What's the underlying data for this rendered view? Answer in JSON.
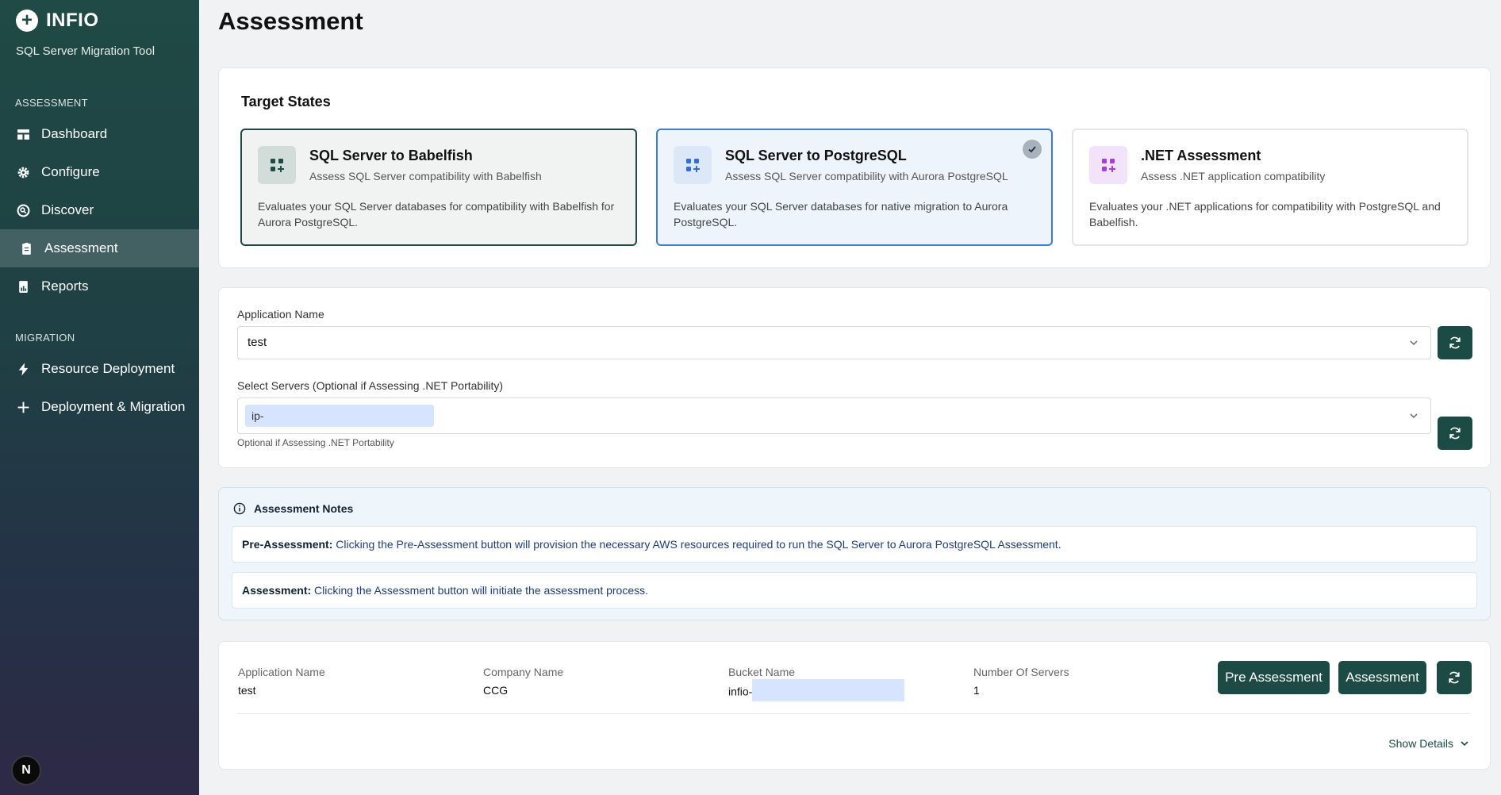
{
  "sidebar": {
    "brand": "INFIO",
    "subtitle": "SQL Server Migration Tool",
    "sections": {
      "assessment": "ASSESSMENT",
      "migration": "MIGRATION"
    },
    "items": {
      "dashboard": "Dashboard",
      "configure": "Configure",
      "discover": "Discover",
      "assessment": "Assessment",
      "reports": "Reports",
      "resource_deployment": "Resource Deployment",
      "deployment_migration": "Deployment & Migration"
    },
    "active_item": "Assessment",
    "badge": "N"
  },
  "page": {
    "title": "Assessment"
  },
  "target_states": {
    "title": "Target States",
    "cards": [
      {
        "title": "SQL Server to Babelfish",
        "subtitle": "Assess SQL Server compatibility with Babelfish",
        "description": "Evaluates your SQL Server databases for compatibility with Babelfish for Aurora PostgreSQL.",
        "icon": "grid-plus-icon",
        "state": "focused"
      },
      {
        "title": "SQL Server to PostgreSQL",
        "subtitle": "Assess SQL Server compatibility with Aurora PostgreSQL",
        "description": "Evaluates your SQL Server databases for native migration to Aurora PostgreSQL.",
        "icon": "grid-plus-icon",
        "state": "selected"
      },
      {
        "title": ".NET Assessment",
        "subtitle": "Assess .NET application compatibility",
        "description": "Evaluates your .NET applications for compatibility with PostgreSQL and Babelfish.",
        "icon": "grid-plus-icon",
        "state": "default"
      }
    ]
  },
  "form": {
    "app_name_label": "Application Name",
    "app_name_value": "test",
    "servers_label": "Select Servers (Optional if Assessing .NET Portability)",
    "servers_tag": "ip-",
    "servers_hint": "Optional if Assessing .NET Portability"
  },
  "notes": {
    "title": "Assessment Notes",
    "items": [
      {
        "label": "Pre-Assessment:",
        "text": "Clicking the Pre-Assessment button will provision the necessary AWS resources required to run the SQL Server to Aurora PostgreSQL Assessment."
      },
      {
        "label": "Assessment:",
        "text": "Clicking the Assessment button will initiate the assessment process."
      }
    ]
  },
  "summary": {
    "columns": [
      {
        "label": "Application Name",
        "value": "test"
      },
      {
        "label": "Company Name",
        "value": "CCG"
      },
      {
        "label": "Bucket Name",
        "value": "infio-"
      },
      {
        "label": "Number Of Servers",
        "value": "1"
      }
    ],
    "pre_assessment_label": "Pre Assessment",
    "assessment_label": "Assessment",
    "show_details_label": "Show Details"
  },
  "colors": {
    "primary": "#1c4a44",
    "selected_border": "#3a7ae2",
    "redaction": "#d6e4ff"
  }
}
